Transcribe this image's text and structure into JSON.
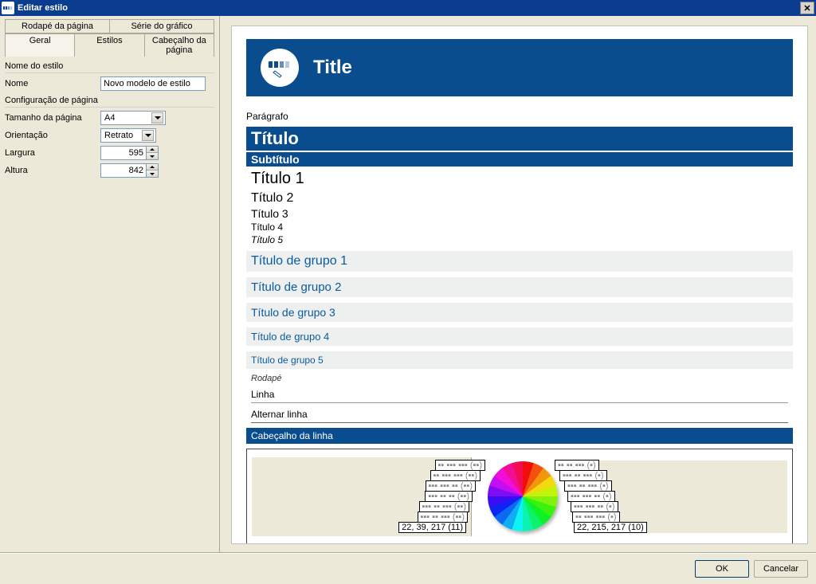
{
  "window": {
    "title": "Editar estilo"
  },
  "tabs_row1": [
    "Rodapé da página",
    "Série do gráfico"
  ],
  "tabs_row2": [
    "Geral",
    "Estilos",
    "Cabeçalho da página"
  ],
  "tabs_active": "Geral",
  "form": {
    "section_name": "Nome do estilo",
    "name_label": "Nome",
    "name_value": "Novo modelo de estilo",
    "section_page": "Configuração de página",
    "pagesize_label": "Tamanho da página",
    "pagesize_value": "A4",
    "orientation_label": "Orientação",
    "orientation_value": "Retrato",
    "width_label": "Largura",
    "width_value": "595",
    "height_label": "Altura",
    "height_value": "842"
  },
  "preview": {
    "header_title": "Title",
    "paragraph": "Parágrafo",
    "title": "Título",
    "subtitle": "Subtítulo",
    "h1": "Título 1",
    "h2": "Título 2",
    "h3": "Título 3",
    "h4": "Título 4",
    "h5": "Título 5",
    "g1": "Título de grupo 1",
    "g2": "Título de grupo 2",
    "g3": "Título de grupo 3",
    "g4": "Título de grupo 4",
    "g5": "Título de grupo 5",
    "footer": "Rodapé",
    "line": "Linha",
    "altline": "Alternar linha",
    "rowheader": "Cabeçalho da linha",
    "legend_left_last": "22, 39, 217 (11)",
    "legend_right_last": "22, 215, 217 (10)"
  },
  "buttons": {
    "ok": "OK",
    "cancel": "Cancelar"
  },
  "chart_data": {
    "type": "pie",
    "title": "",
    "note": "decorative style-preview pie; equal slices in rainbow hues with RGB-like legend boxes",
    "slices": 20,
    "legend_left": [
      "22, 39, 217 (11)"
    ],
    "legend_right": [
      "22, 215, 217 (10)"
    ]
  }
}
